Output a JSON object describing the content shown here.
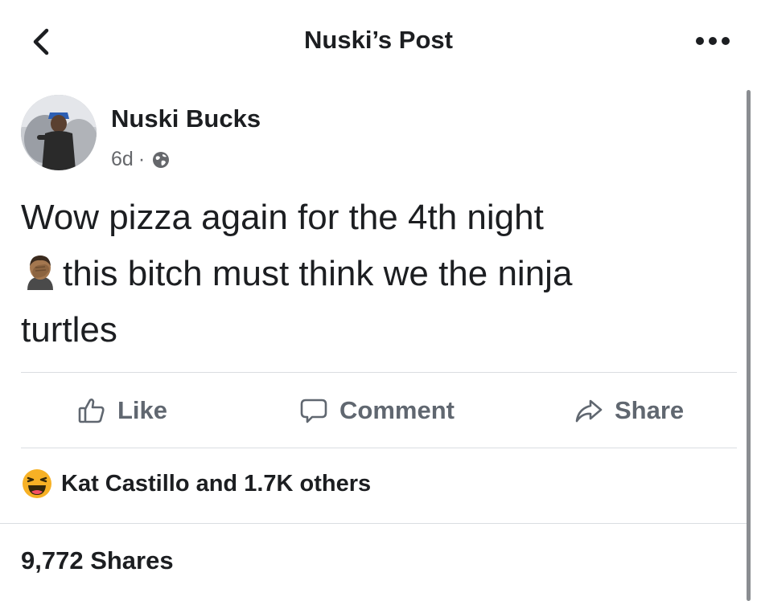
{
  "header": {
    "title": "Nuski’s Post",
    "back_icon": "chevron-left-icon",
    "more_icon": "more-dots-icon"
  },
  "post": {
    "author": "Nuski Bucks",
    "time": "6d",
    "separator": "·",
    "privacy_icon": "globe-icon",
    "text_lines": [
      "Wow pizza again for the 4th night",
      "this bitch must think we the ninja",
      "turtles"
    ],
    "inline_emoji": "man-facepalming-emoji"
  },
  "actions": {
    "like_label": "Like",
    "comment_label": "Comment",
    "share_label": "Share"
  },
  "reactions": {
    "icon": "haha-emoji",
    "text": "Kat Castillo and 1.7K others"
  },
  "shares": {
    "text": "9,772 Shares"
  },
  "colors": {
    "text_primary": "#1c1e21",
    "text_secondary": "#65676b",
    "action_gray": "#606770",
    "divider": "#dadde1",
    "haha_yellow": "#f7b125"
  }
}
